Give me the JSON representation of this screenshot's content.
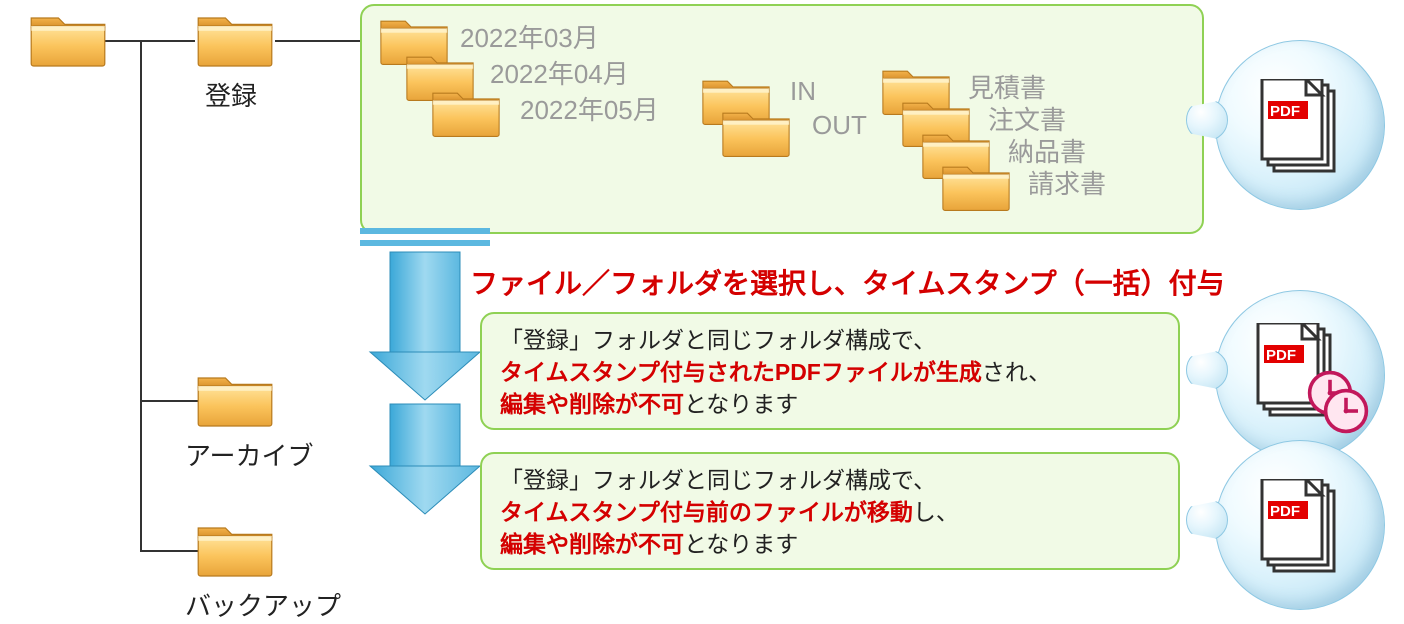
{
  "rootFolders": {
    "register": "登録",
    "archive": "アーカイブ",
    "backup": "バックアップ"
  },
  "months": [
    "2022年03月",
    "2022年04月",
    "2022年05月"
  ],
  "inout": {
    "in": "IN",
    "out": "OUT"
  },
  "docTypes": [
    "見積書",
    "注文書",
    "納品書",
    "請求書"
  ],
  "pdfLabel": "PDF",
  "action": "ファイル／フォルダを選択し、タイムスタンプ（一括）付与",
  "box1": {
    "line1": "「登録」フォルダと同じフォルダ構成で、",
    "red1": "タイムスタンプ付与されたPDFファイルが生成",
    "tail1": "され、",
    "red2": "編集や削除が不可",
    "tail2": "となります"
  },
  "box2": {
    "line1": "「登録」フォルダと同じフォルダ構成で、",
    "red1": "タイムスタンプ付与前のファイルが移動",
    "tail1": "し、",
    "red2": "編集や削除が不可",
    "tail2": "となります"
  }
}
